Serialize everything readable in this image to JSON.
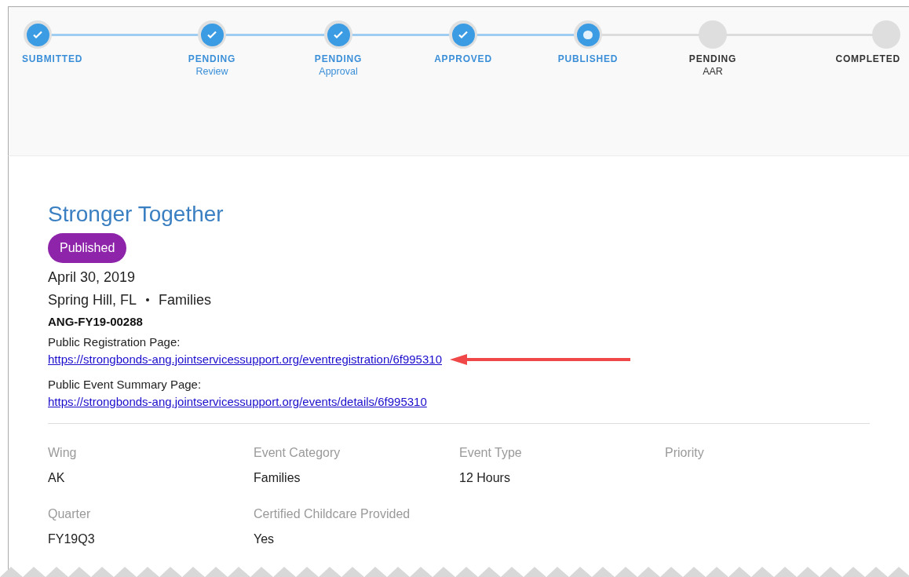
{
  "steps": [
    {
      "label": "SUBMITTED",
      "kind": "done"
    },
    {
      "label": "PENDING",
      "sub": "Review",
      "kind": "done"
    },
    {
      "label": "PENDING",
      "sub": "Approval",
      "kind": "done"
    },
    {
      "label": "APPROVED",
      "kind": "done"
    },
    {
      "label": "PUBLISHED",
      "kind": "current"
    },
    {
      "label": "PENDING",
      "sub": "AAR",
      "kind": "todo"
    },
    {
      "label": "COMPLETED",
      "kind": "todo"
    }
  ],
  "event": {
    "title": "Stronger Together",
    "status": "Published",
    "date": "April 30, 2019",
    "location": "Spring Hill, FL",
    "audience": "Families",
    "code": "ANG-FY19-00288",
    "links": [
      {
        "label": "Public Registration Page:",
        "url": "https://strongbonds-ang.jointservicessupport.org/eventregistration/6f995310",
        "annotated": true
      },
      {
        "label": "Public Event Summary Page:",
        "url": "https://strongbonds-ang.jointservicessupport.org/events/details/6f995310",
        "annotated": false
      }
    ]
  },
  "fields": [
    {
      "label": "Wing",
      "value": "AK"
    },
    {
      "label": "Event Category",
      "value": "Families"
    },
    {
      "label": "Event Type",
      "value": "12 Hours"
    },
    {
      "label": "Priority"
    },
    {
      "label": "Quarter",
      "value": "FY19Q3"
    },
    {
      "label": "Certified Childcare Provided",
      "value": "Yes"
    }
  ]
}
